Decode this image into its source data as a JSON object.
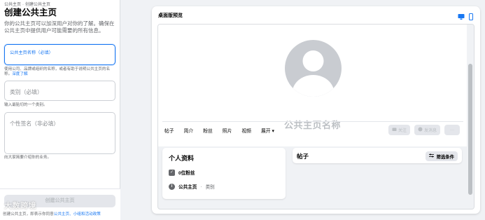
{
  "left": {
    "breadcrumb": [
      "公共主页",
      "创建公共主页"
    ],
    "title": "创建公共主页",
    "description": "你的公共主页可以加深用户对你的了解。确保在公共主页中提供用户可能需要的所有信息。",
    "name_field": {
      "label": "公共主页名称（必填）",
      "value": ""
    },
    "name_helper": "使用公司、品牌或组织的名称，或者有助于说明公共主页的名称。",
    "name_helper_link": "深度了解",
    "category_field": {
      "placeholder": "类别（必填）"
    },
    "category_helper": "输入最贴切的一个类别。",
    "bio_field": {
      "placeholder": "个性签名（非必填）"
    },
    "bio_helper": "向大家简要介绍你的业务。",
    "create_button": "创建公共主页",
    "terms_prefix": "创建公共主页，即表示你同意",
    "terms_link": "公共主页、小组和活动政策",
    "watermark": "大数跨境"
  },
  "preview": {
    "label": "桌面版预览",
    "devices": [
      "desktop-icon",
      "mobile-icon"
    ],
    "page_name": "公共主页名称",
    "tabs": [
      "帖子",
      "简介",
      "粉丝",
      "照片",
      "视频",
      "展开 ▾"
    ],
    "actions": {
      "follow": "关注",
      "message": "发消息",
      "more": "···"
    },
    "intro": {
      "title": "个人资料",
      "followers": "0位粉丝",
      "type_label": "公共主页",
      "type_value": "类别"
    },
    "posts": {
      "title": "帖子",
      "filter": "筛选条件"
    }
  },
  "colors": {
    "accent": "#1877f2",
    "muted": "#65676b",
    "disabled": "#bcc0c4"
  }
}
